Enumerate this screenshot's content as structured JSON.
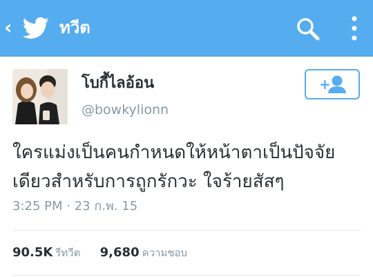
{
  "colors": {
    "brand": "#55acee",
    "text": "#292f33",
    "muted": "#8899a6"
  },
  "appbar": {
    "title": "ทวีต",
    "back_icon": "chevron-left-icon",
    "logo_icon": "twitter-bird-icon",
    "search_icon": "search-icon",
    "menu_icon": "overflow-menu-icon"
  },
  "tweet": {
    "display_name": "โบกี้ไลอ้อน",
    "handle": "@bowkylionn",
    "text_line1": "ใครแม่งเป็นคนกำหนดให้หน้าตาเป็นปัจจัย",
    "text_line2": "เดียวสำหรับการถูกรักวะ ใจร้ายสัสๆ",
    "timestamp": "3:25 PM · 23 ก.พ. 15",
    "follow_icon": "add-user-icon",
    "follow_plus": "+"
  },
  "stats": {
    "retweets_count": "90.5K",
    "retweets_label": "รีทวีต",
    "likes_count": "9,680",
    "likes_label": "ความชอบ"
  }
}
